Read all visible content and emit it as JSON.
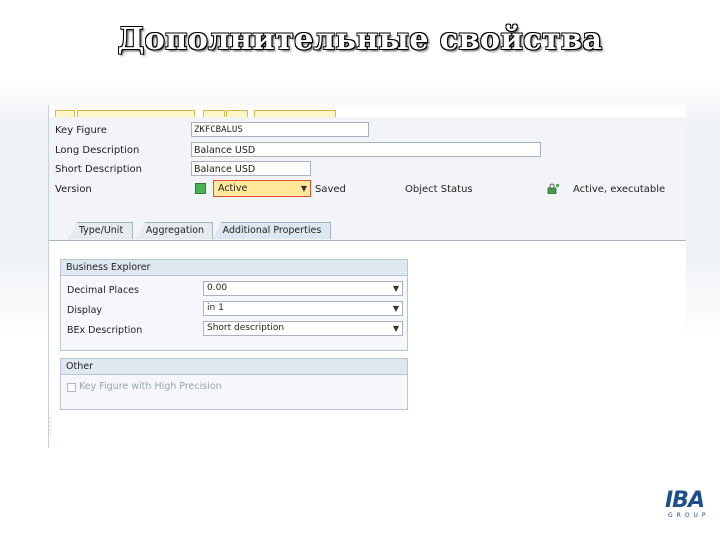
{
  "slide": {
    "title": "Дополнительные свойства",
    "logo_main": "IBA",
    "logo_sub": "GROUP"
  },
  "header": {
    "key_figure_label": "Key Figure",
    "key_figure_value": "ZKFCBALUS",
    "long_desc_label": "Long Description",
    "long_desc_value": "Balance USD",
    "short_desc_label": "Short Description",
    "short_desc_value": "Balance USD",
    "version_label": "Version",
    "version_value": "Active",
    "saved_text": "Saved",
    "object_status_label": "Object Status",
    "object_status_value": "Active, executable"
  },
  "tabs": [
    {
      "label": "Type/Unit"
    },
    {
      "label": "Aggregation"
    },
    {
      "label": "Additional Properties"
    }
  ],
  "business_explorer": {
    "title": "Business Explorer",
    "rows": [
      {
        "label": "Decimal Places",
        "value": "0.00"
      },
      {
        "label": "Display",
        "value": "in 1"
      },
      {
        "label": "BEx Description",
        "value": "Short description"
      }
    ]
  },
  "other": {
    "title": "Other",
    "checkbox_label": "Key Figure with High Precision"
  },
  "colors": {
    "status_ok": "#46b450",
    "version_highlight": "#ffe89a",
    "logo": "#1f4e8a"
  }
}
